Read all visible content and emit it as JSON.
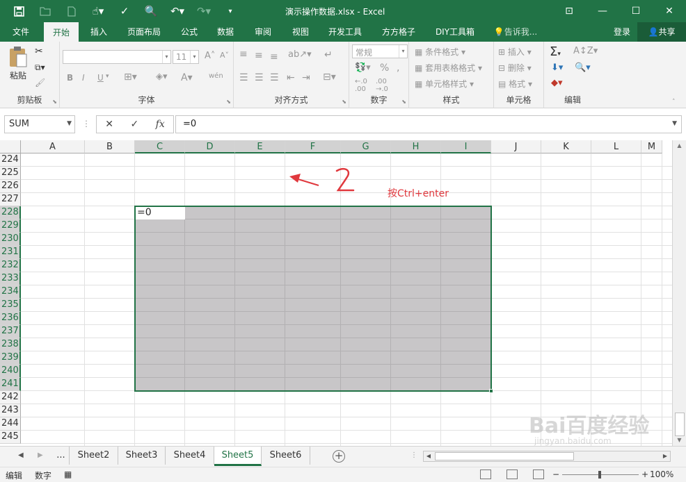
{
  "window": {
    "title": "演示操作数据.xlsx - Excel"
  },
  "ribbon_tabs": [
    {
      "label": "文件",
      "active": false
    },
    {
      "label": "开始",
      "active": true
    },
    {
      "label": "插入",
      "active": false
    },
    {
      "label": "页面布局",
      "active": false
    },
    {
      "label": "公式",
      "active": false
    },
    {
      "label": "数据",
      "active": false
    },
    {
      "label": "审阅",
      "active": false
    },
    {
      "label": "视图",
      "active": false
    },
    {
      "label": "开发工具",
      "active": false
    },
    {
      "label": "方方格子",
      "active": false
    },
    {
      "label": "DIY工具箱",
      "active": false
    }
  ],
  "tellme": "告诉我...",
  "signin": "登录",
  "share": "共享",
  "ribbon": {
    "clipboard": {
      "label": "剪贴板",
      "paste": "粘贴"
    },
    "font": {
      "label": "字体",
      "size": "11",
      "bold": "B",
      "italic": "I",
      "underline": "U",
      "fontcolor": "A",
      "phonetic": "wén"
    },
    "alignment": {
      "label": "对齐方式"
    },
    "number": {
      "label": "数字",
      "format": "常规",
      "percent": "%",
      "comma": ","
    },
    "styles": {
      "label": "样式",
      "conditional": "条件格式",
      "table": "套用表格格式",
      "cellstyle": "单元格样式"
    },
    "cells": {
      "label": "单元格",
      "insert": "插入",
      "delete": "删除",
      "format": "格式"
    },
    "editing": {
      "label": "编辑",
      "sum": "Σ"
    }
  },
  "formula_bar": {
    "namebox": "SUM",
    "cancel": "✕",
    "enter": "✓",
    "fx": "fx",
    "formula": "=0"
  },
  "columns": [
    "A",
    "B",
    "C",
    "D",
    "E",
    "F",
    "G",
    "H",
    "I",
    "J",
    "K",
    "L",
    "M"
  ],
  "selected_columns": [
    "C",
    "D",
    "E",
    "F",
    "G",
    "H",
    "I"
  ],
  "rows": [
    "224",
    "225",
    "226",
    "227",
    "228",
    "229",
    "230",
    "231",
    "232",
    "233",
    "234",
    "235",
    "236",
    "237",
    "238",
    "239",
    "240",
    "241",
    "242",
    "243",
    "244",
    "245"
  ],
  "selected_rows": [
    "228",
    "229",
    "230",
    "231",
    "232",
    "233",
    "234",
    "235",
    "236",
    "237",
    "238",
    "239",
    "240",
    "241"
  ],
  "active_cell": {
    "ref": "C228",
    "value": "=0"
  },
  "annotation": {
    "number": "2",
    "text": "按Ctrl+enter"
  },
  "sheets": {
    "ellipsis": "...",
    "tabs": [
      {
        "label": "Sheet2",
        "active": false
      },
      {
        "label": "Sheet3",
        "active": false
      },
      {
        "label": "Sheet4",
        "active": false
      },
      {
        "label": "Sheet5",
        "active": true
      },
      {
        "label": "Sheet6",
        "active": false
      }
    ]
  },
  "status": {
    "mode": "编辑",
    "numlock": "数字",
    "zoom": "100%"
  },
  "watermark": {
    "brand": "Bai百度经验",
    "url": "jingyan.baidu.com"
  },
  "colors": {
    "accent": "#217346",
    "selection": "#c8c6c8",
    "annotation": "#e0383d"
  }
}
